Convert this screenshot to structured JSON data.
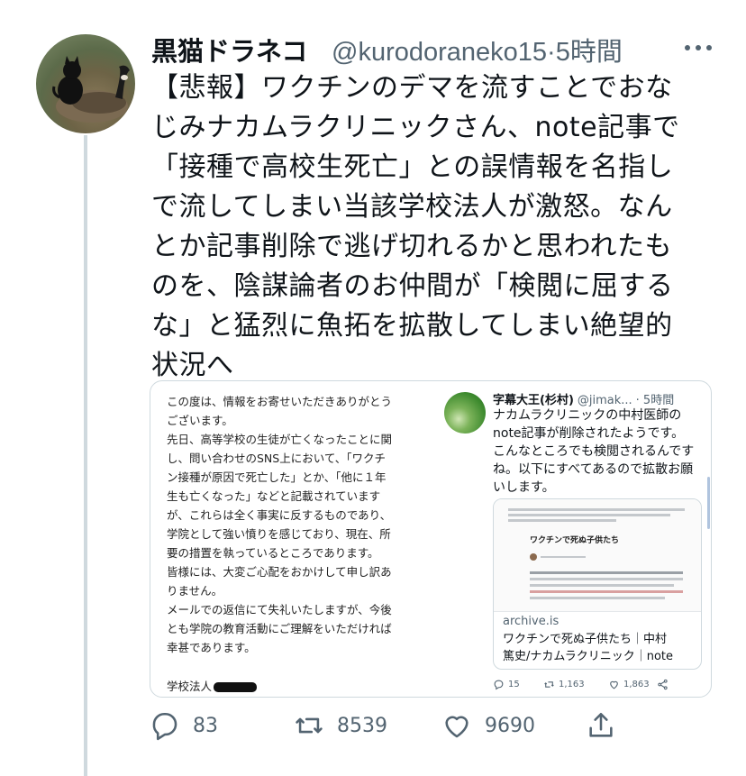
{
  "tweet": {
    "author_name": "黒猫ドラネコ",
    "author_handle": "@kurodoraneko15",
    "separator": "·",
    "time": "5時間",
    "text_lines": [
      "【悲報】ワクチンのデマを流すことでおな",
      "じみナカムラクリニックさん、note記事で",
      "「接種で高校生死亡」との誤情報を名指し",
      "で流してしまい当該学校法人が激怒。なん",
      "とか記事削除で逃げ切れるかと思われたも",
      "のを、陰謀論者のお仲間が「検閲に屈する",
      "な」と猛烈に魚拓を拡散してしまい絶望的",
      "状況へ"
    ],
    "icons": {
      "more": "more-icon",
      "reply": "reply-icon",
      "retweet": "retweet-icon",
      "like": "like-icon",
      "share": "share-icon"
    },
    "actions": {
      "reply_count": "83",
      "retweet_count": "8539",
      "like_count": "9690"
    }
  },
  "media": {
    "letter_lines": [
      "この度は、情報をお寄せいただきありがとう",
      "ございます。",
      "先日、高等学校の生徒が亡くなったことに関",
      "し、問い合わせのSNS上において、「ワクチ",
      "ン接種が原因で死亡した」とか、「他に１年",
      "生も亡くなった」などと記載されています",
      "が、これらは全く事実に反するものであり、",
      "学院として強い憤りを感じており、現在、所",
      "要の措置を執っているところであります。",
      "皆様には、大変ご心配をおかけして申し訳あ",
      "りません。",
      "メールでの返信にて失礼いたしますが、今後",
      "とも学院の教育活動にご理解をいただければ",
      "幸甚であります。"
    ],
    "letter_signature": "学校法人",
    "quoted": {
      "name": "字幕大王(杉村)",
      "handle": "@jimak...",
      "time": "· 5時間",
      "text_lines": [
        "ナカムラクリニックの中村医師の",
        "note記事が削除されたようです。",
        "こんなところでも検閲されるんです",
        "ね。以下にすべてあるので拡散お願",
        "いします。"
      ],
      "link_card": {
        "thumb_title": "ワクチンで死ぬ子供たち",
        "domain": "archive.is",
        "title_lines": [
          "ワクチンで死ぬ子供たち｜中村",
          "篤史/ナカムラクリニック｜note"
        ]
      },
      "actions": {
        "reply_count": "15",
        "retweet_count": "1,163",
        "like_count": "1,863"
      }
    }
  }
}
